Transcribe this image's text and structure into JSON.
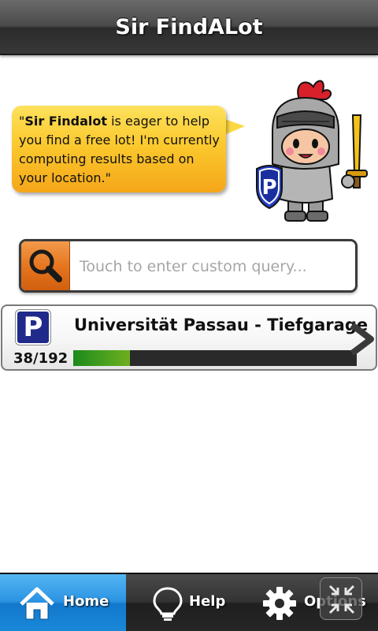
{
  "header": {
    "title": "Sir FindALot"
  },
  "bubble": {
    "name_bold": "Sir Findalot",
    "open_quote": "\"",
    "message": " is eager to help you find a free lot! I'm currently computing results based on your location.\""
  },
  "search": {
    "placeholder": "Touch to enter custom query...",
    "value": "",
    "icon": "search-icon"
  },
  "lots": [
    {
      "icon": "parking-icon",
      "icon_letter": "P",
      "name": "Universität Passau - Tiefgarage",
      "count_label": "38/192",
      "free": 38,
      "total": 192,
      "occupancy_fill_fraction": 0.2
    }
  ],
  "tabs": [
    {
      "label": "Home",
      "icon": "home-icon",
      "active": true
    },
    {
      "label": "Help",
      "icon": "lightbulb-icon",
      "active": false
    },
    {
      "label": "Options",
      "icon": "gear-icon",
      "active": false
    }
  ],
  "colors": {
    "accent_orange": "#e5731c",
    "bubble_yellow": "#fbc92e",
    "active_tab_blue": "#2a93e2",
    "parking_blue": "#1f2a8a",
    "bar_green": "#1b8a1b"
  }
}
